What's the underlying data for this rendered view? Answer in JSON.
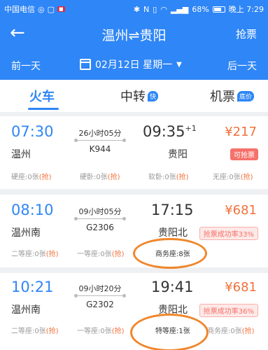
{
  "status": {
    "carrier": "中国电信",
    "battery": "68%",
    "time": "晚上 7:29"
  },
  "header": {
    "title": "温州⇌贵阳",
    "grab_label": "抢票"
  },
  "datebar": {
    "prev": "前一天",
    "date": "02月12日 星期一",
    "next": "后一天"
  },
  "tabs": {
    "train": "火车",
    "transfer": "中转",
    "transfer_badge": "快",
    "flight": "机票",
    "flight_badge": "底价"
  },
  "trains": [
    {
      "dep_time": "07:30",
      "dep_station": "温州",
      "duration": "26小时05分",
      "train_no": "K944",
      "arr_time": "09:35",
      "arr_day": "+1",
      "arr_station": "贵阳",
      "price": "¥217",
      "tag": "可抢票",
      "seats": [
        "硬座:0张",
        "硬卧:0张",
        "软卧:0张",
        "无座:0张"
      ],
      "grab": "(抢)"
    },
    {
      "dep_time": "08:10",
      "dep_station": "温州南",
      "duration": "09小时05分",
      "train_no": "G2306",
      "arr_time": "17:15",
      "arr_station": "贵阳北",
      "price": "¥681",
      "tag": "抢票成功率33%",
      "seats": [
        "二等座:0张",
        "一等座:0张",
        "商务座:8张"
      ],
      "grab": "(抢)"
    },
    {
      "dep_time": "10:21",
      "dep_station": "温州南",
      "duration": "09小时20分",
      "train_no": "G2302",
      "arr_time": "19:41",
      "arr_station": "贵阳北",
      "price": "¥681",
      "tag": "抢票成功率36%",
      "seats": [
        "二等座:0张",
        "一等座:0张",
        "特等座:1张",
        "商务座:0张"
      ],
      "grab": "(抢)"
    }
  ]
}
